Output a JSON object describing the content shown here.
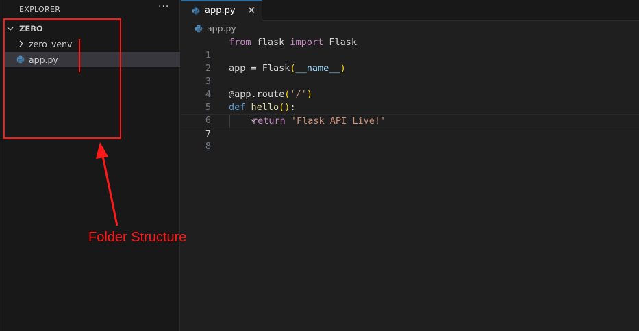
{
  "sidebar": {
    "header": "EXPLORER",
    "more_actions": "···",
    "root_folder": "ZERO",
    "items": [
      {
        "label": "zero_venv",
        "type": "folder",
        "expanded": false
      },
      {
        "label": "app.py",
        "type": "file",
        "selected": true
      }
    ]
  },
  "tabs": [
    {
      "label": "app.py",
      "active": true,
      "close": "✕"
    }
  ],
  "breadcrumb": {
    "file": "app.py"
  },
  "editor": {
    "active_line": 7,
    "lines": [
      {
        "n": "1"
      },
      {
        "n": "2"
      },
      {
        "n": "3"
      },
      {
        "n": "4"
      },
      {
        "n": "5"
      },
      {
        "n": "6"
      },
      {
        "n": "7"
      },
      {
        "n": "8"
      }
    ],
    "tokens": {
      "l1_from": "from",
      "l1_flask": " flask ",
      "l1_import": "import",
      "l1_Flask": " Flask",
      "l3_app": "app = Flask",
      "l3_open": "(",
      "l3_name": "__name__",
      "l3_close": ")",
      "l5_deco": "@app.route",
      "l5_open": "(",
      "l5_str": "'/'",
      "l5_close": ")",
      "l6_def": "def",
      "l6_fn": " hello",
      "l6_parens": "()",
      "l6_colon": ":",
      "l7_return": "return",
      "l7_str": " 'Flask API Live!'"
    }
  },
  "annotation": {
    "label": "Folder Structure",
    "color": "#ff1a1a"
  },
  "colors": {
    "sidebar_bg": "#181818",
    "editor_bg": "#1f1f1f",
    "selection_bg": "#37373d",
    "accent": "#0078d4"
  },
  "icons": {
    "file": "python-icon",
    "folder_chevron": "chevron-right-icon",
    "root_chevron": "chevron-down-icon",
    "fold_chevron": "chevron-down-icon"
  }
}
